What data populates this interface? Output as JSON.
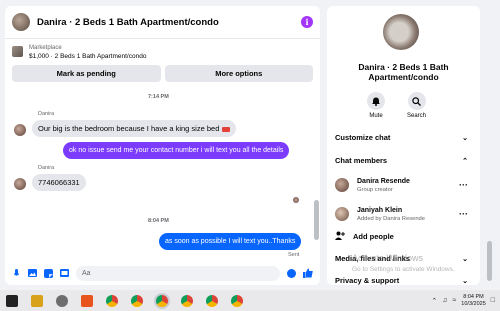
{
  "header": {
    "title": "Danira · 2 Beds 1 Bath Apartment/condo"
  },
  "marketplace": {
    "label": "Marketplace",
    "listing": "$1,000 · 2 Beds 1 Bath Apartment/condo",
    "btn_pending": "Mark as pending",
    "btn_more": "More options"
  },
  "messages": {
    "time1": "7:14 PM",
    "sender1": "Danira",
    "msg1": "Our big is the bedroom because I have a king size bed",
    "msg2": "ok no issue send me your contact number i will text you all the details",
    "sender2": "Danira",
    "msg3": "7746066331",
    "time2": "8:04 PM",
    "msg4": "as soon as possible I will text you..Thanks",
    "sent": "Sent"
  },
  "composer": {
    "placeholder": "Aa"
  },
  "side": {
    "title": "Danira · 2 Beds 1 Bath Apartment/condo",
    "mute": "Mute",
    "search": "Search",
    "customize": "Customize chat",
    "members_header": "Chat members",
    "members": [
      {
        "name": "Danira Resende",
        "sub": "Group creator"
      },
      {
        "name": "Janiyah Klein",
        "sub": "Added by Danira Resende"
      }
    ],
    "add_people": "Add people",
    "media": "Media, files and links",
    "privacy": "Privacy & support"
  },
  "watermark": {
    "line1": "Activate Windows",
    "line2": "Go to Settings to activate Windows."
  },
  "taskbar": {
    "time": "8:04 PM",
    "date": "10/3/2025"
  },
  "colors": {
    "accent_purple": "#7b3cff",
    "accent_blue": "#0866ff",
    "info": "#a334fa"
  }
}
